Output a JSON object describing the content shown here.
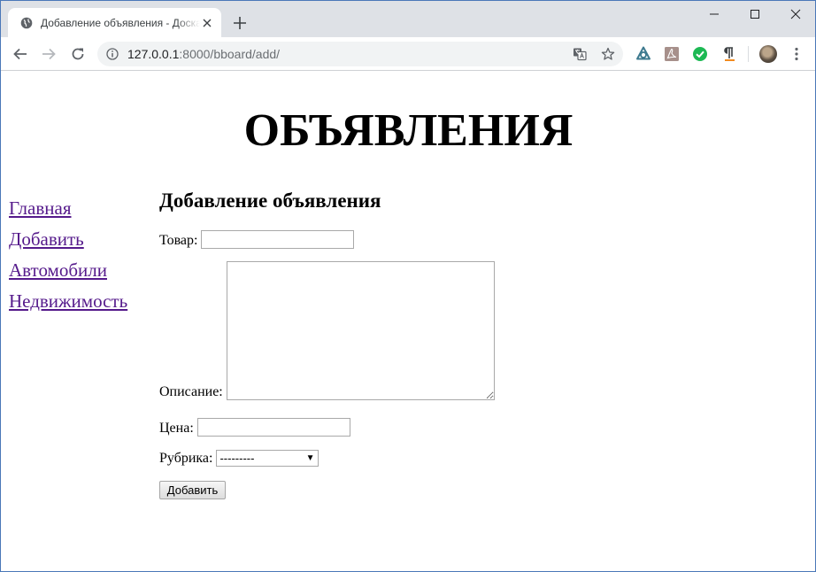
{
  "browser": {
    "tab_title": "Добавление объявления - Доска объявлений",
    "url_host": "127.0.0.1",
    "url_rest": ":8000/bboard/add/"
  },
  "page": {
    "site_title": "ОБЪЯВЛЕНИЯ",
    "nav": [
      {
        "label": "Главная"
      },
      {
        "label": "Добавить"
      },
      {
        "label": "Автомобили"
      },
      {
        "label": "Недвижимость"
      }
    ],
    "form": {
      "heading": "Добавление объявления",
      "title_label": "Товар:",
      "title_value": "",
      "content_label": "Описание:",
      "content_value": "",
      "price_label": "Цена:",
      "price_value": "",
      "rubric_label": "Рубрика:",
      "rubric_selected": "---------",
      "submit_label": "Добавить"
    }
  },
  "colors": {
    "tabstrip": "#dee1e6",
    "visited_link": "#551a8b",
    "omnibox": "#f1f3f4"
  },
  "icons": [
    "globe-icon",
    "close-icon",
    "plus-icon",
    "minimize-icon",
    "maximize-icon",
    "back-icon",
    "forward-icon",
    "reload-icon",
    "info-icon",
    "translate-icon",
    "star-icon",
    "menu-icon"
  ]
}
